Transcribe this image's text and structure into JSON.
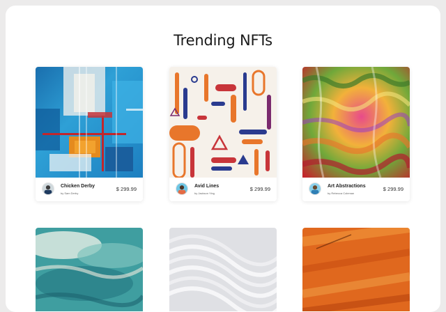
{
  "page": {
    "title": "Trending NFTs"
  },
  "cards": [
    {
      "title": "Chicken Derby",
      "author": "by Sam Derby",
      "price": "$ 299.99",
      "art": "blue-abstract-painting"
    },
    {
      "title": "Avid Lines",
      "author": "by Jackson Ying",
      "price": "$ 299.99",
      "art": "colorful-geometric-lines"
    },
    {
      "title": "Art Abstractions",
      "author": "by Rebecca Coleman",
      "price": "$ 299.99",
      "art": "rainbow-swirl-painting"
    }
  ],
  "more_cards": [
    {
      "art": "teal-watercolor-texture"
    },
    {
      "art": "white-wave-lines"
    },
    {
      "art": "orange-brushstroke-texture"
    }
  ],
  "colors": {
    "background": "#ecebeb",
    "panel": "#ffffff",
    "text": "#1a1a1a"
  }
}
